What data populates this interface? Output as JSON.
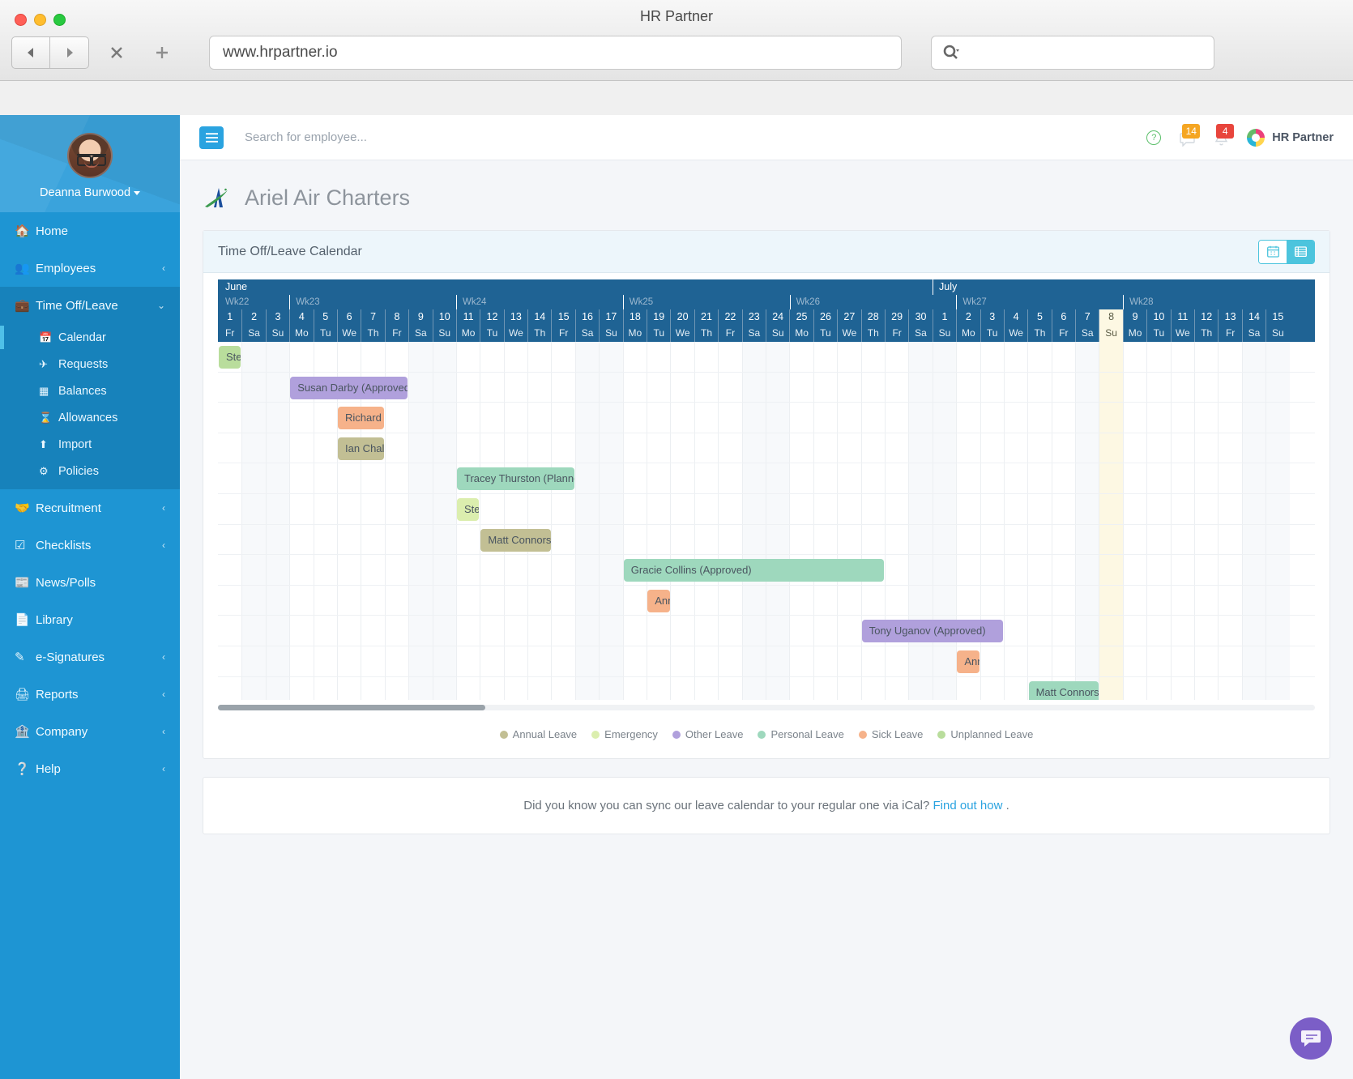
{
  "browser": {
    "window_title": "HR Partner",
    "url": "www.hrpartner.io",
    "back_icon": "back-arrow-icon",
    "forward_icon": "forward-arrow-icon",
    "stop_icon": "close-x-icon",
    "new_tab_icon": "plus-icon",
    "search_icon": "search-icon"
  },
  "sidebar": {
    "user": {
      "name": "Deanna Burwood"
    },
    "items": [
      {
        "label": "Home",
        "icon": "home-icon",
        "expandable": false
      },
      {
        "label": "Employees",
        "icon": "users-icon",
        "expandable": true,
        "chevron": "‹"
      },
      {
        "label": "Time Off/Leave",
        "icon": "briefcase-icon",
        "expandable": true,
        "chevron": "⌄",
        "active": true
      },
      {
        "label": "Recruitment",
        "icon": "handshake-icon",
        "expandable": true,
        "chevron": "‹"
      },
      {
        "label": "Checklists",
        "icon": "check-square-icon",
        "expandable": true,
        "chevron": "‹"
      },
      {
        "label": "News/Polls",
        "icon": "newspaper-icon",
        "expandable": false
      },
      {
        "label": "Library",
        "icon": "file-icon",
        "expandable": false
      },
      {
        "label": "e-Signatures",
        "icon": "pencil-icon",
        "expandable": true,
        "chevron": "‹"
      },
      {
        "label": "Reports",
        "icon": "printer-icon",
        "expandable": true,
        "chevron": "‹"
      },
      {
        "label": "Company",
        "icon": "bank-icon",
        "expandable": true,
        "chevron": "‹"
      },
      {
        "label": "Help",
        "icon": "question-circle-icon",
        "expandable": true,
        "chevron": "‹"
      }
    ],
    "submenu": [
      {
        "label": "Calendar",
        "icon": "calendar-icon",
        "current": true
      },
      {
        "label": "Requests",
        "icon": "plane-icon",
        "current": false
      },
      {
        "label": "Balances",
        "icon": "table-icon",
        "current": false
      },
      {
        "label": "Allowances",
        "icon": "hourglass-icon",
        "current": false
      },
      {
        "label": "Import",
        "icon": "upload-icon",
        "current": false
      },
      {
        "label": "Policies",
        "icon": "gear-icon",
        "current": false
      }
    ]
  },
  "topbar": {
    "menu_icon": "hamburger-icon",
    "search_placeholder": "Search for employee...",
    "help_icon": "question-circle-icon",
    "messages_icon": "comment-icon",
    "messages_count": "14",
    "messages_badge_color": "#f5a623",
    "alerts_icon": "bell-icon",
    "alerts_count": "4",
    "alerts_badge_color": "#e8453c",
    "brand_name": "HR Partner"
  },
  "page": {
    "title": "Ariel Air Charters",
    "logo_icon": "ariel-air-charters-logo"
  },
  "calendar_card": {
    "heading": "Time Off/Leave Calendar",
    "view_calendar_icon": "calendar-view-icon",
    "view_list_icon": "list-view-icon",
    "active_view": "list"
  },
  "chart_data": {
    "type": "table",
    "title": "Time Off/Leave Calendar",
    "months": [
      {
        "name": "June",
        "days": 30
      },
      {
        "name": "July",
        "days": 15
      }
    ],
    "weeks": [
      {
        "label": "Wk22",
        "days": 3
      },
      {
        "label": "Wk23",
        "days": 7
      },
      {
        "label": "Wk24",
        "days": 7
      },
      {
        "label": "Wk25",
        "days": 7
      },
      {
        "label": "Wk26",
        "days": 7
      },
      {
        "label": "Wk27",
        "days": 7
      },
      {
        "label": "Wk28",
        "days": 7
      }
    ],
    "day_numbers": [
      1,
      2,
      3,
      4,
      5,
      6,
      7,
      8,
      9,
      10,
      11,
      12,
      13,
      14,
      15,
      16,
      17,
      18,
      19,
      20,
      21,
      22,
      23,
      24,
      25,
      26,
      27,
      28,
      29,
      30,
      1,
      2,
      3,
      4,
      5,
      6,
      7,
      8,
      9,
      10,
      11,
      12,
      13,
      14,
      15
    ],
    "day_names": [
      "Fr",
      "Sa",
      "Su",
      "Mo",
      "Tu",
      "We",
      "Th",
      "Fr",
      "Sa",
      "Su",
      "Mo",
      "Tu",
      "We",
      "Th",
      "Fr",
      "Sa",
      "Su",
      "Mo",
      "Tu",
      "We",
      "Th",
      "Fr",
      "Sa",
      "Su",
      "Mo",
      "Tu",
      "We",
      "Th",
      "Fr",
      "Sa",
      "Su",
      "Mo",
      "Tu",
      "We",
      "Th",
      "Fr",
      "Sa",
      "Su",
      "Mo",
      "Tu",
      "We",
      "Th",
      "Fr",
      "Sa",
      "Su"
    ],
    "today_index": 37,
    "today_label": "8 Su",
    "events": [
      {
        "label": "Stephanie Adams (Approved)",
        "row": 0,
        "start": 0,
        "span": 1,
        "type": "Unplanned Leave",
        "color": "#b9dd9c"
      },
      {
        "label": "Susan Darby (Approved)",
        "row": 1,
        "start": 3,
        "span": 5,
        "type": "Other Leave",
        "color": "#b0a0dc"
      },
      {
        "label": "Richard Carmichael (Approved)",
        "row": 2,
        "start": 5,
        "span": 2,
        "type": "Sick Leave",
        "color": "#f6b28a"
      },
      {
        "label": "Ian Chalmers (Approved)",
        "row": 3,
        "start": 5,
        "span": 2,
        "type": "Annual Leave",
        "color": "#c2bf94"
      },
      {
        "label": "Tracey Thurston (Planned)",
        "row": 4,
        "start": 10,
        "span": 5,
        "type": "Personal Leave",
        "color": "#9ed8bd"
      },
      {
        "label": "Stephanie Adams (Approved)",
        "row": 5,
        "start": 10,
        "span": 1,
        "type": "Unplanned Leave",
        "color": "#dbeeae"
      },
      {
        "label": "Matt Connors (Approved)",
        "row": 6,
        "start": 11,
        "span": 3,
        "type": "Annual Leave",
        "color": "#c2bf94"
      },
      {
        "label": "Gracie Collins (Approved)",
        "row": 7,
        "start": 17,
        "span": 11,
        "type": "Personal Leave",
        "color": "#9ed8bd"
      },
      {
        "label": "Annette Jones (Approved)",
        "row": 8,
        "start": 18,
        "span": 1,
        "type": "Sick Leave",
        "color": "#f6b28a"
      },
      {
        "label": "Tony Uganov (Approved)",
        "row": 9,
        "start": 27,
        "span": 6,
        "type": "Other Leave",
        "color": "#b0a0dc"
      },
      {
        "label": "Annette Jones (Approved)",
        "row": 10,
        "start": 31,
        "span": 1,
        "type": "Sick Leave",
        "color": "#f6b28a"
      },
      {
        "label": "Matt Connors (Approved)",
        "row": 11,
        "start": 34,
        "span": 3,
        "type": "Personal Leave",
        "color": "#9ed8bd"
      }
    ],
    "legend": [
      {
        "label": "Annual Leave",
        "color": "#c2bf94"
      },
      {
        "label": "Emergency",
        "color": "#dbeeae"
      },
      {
        "label": "Other Leave",
        "color": "#b0a0dc"
      },
      {
        "label": "Personal Leave",
        "color": "#9ed8bd"
      },
      {
        "label": "Sick Leave",
        "color": "#f6b28a"
      },
      {
        "label": "Unplanned Leave",
        "color": "#b9dd9c"
      }
    ]
  },
  "ical": {
    "text": "Did you know you can sync our leave calendar to your regular one via iCal?",
    "link": "Find out how",
    "suffix": "."
  },
  "chat": {
    "icon": "chat-icon"
  }
}
